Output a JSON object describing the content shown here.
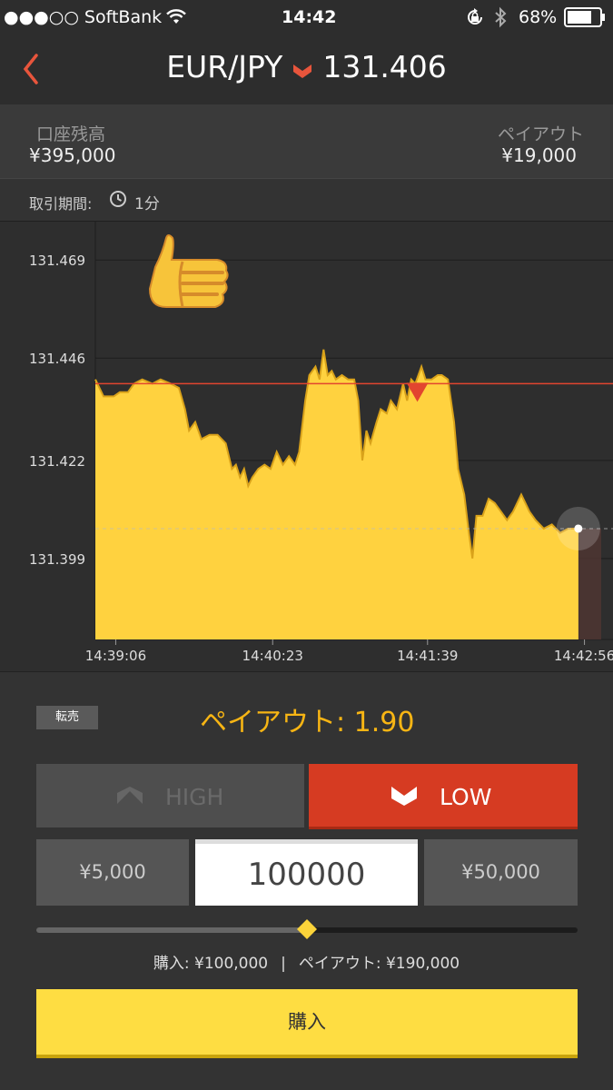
{
  "status_bar": {
    "carrier": "●●●○○ SoftBank",
    "time": "14:42",
    "battery": "68%"
  },
  "header": {
    "pair": "EUR/JPY",
    "price": "131.406",
    "direction_icon": "chevron-down-icon"
  },
  "account": {
    "balance_label": "口座残高",
    "balance_value": "¥395,000",
    "payout_label": "ペイアウト",
    "payout_value": "¥19,000"
  },
  "period": {
    "label": "取引期間:",
    "value": "1分"
  },
  "chart_data": {
    "type": "area",
    "yticks": [
      "131.469",
      "131.446",
      "131.422",
      "131.399"
    ],
    "xticks": [
      "14:39:06",
      "14:40:23",
      "14:41:39",
      "14:42:56"
    ],
    "ylim": [
      131.38,
      131.478
    ],
    "xlim": [
      "14:38:56",
      "14:43:10"
    ],
    "entry_rate": 131.44,
    "entry_marker_time": "14:41:34",
    "current_rate": 131.406,
    "current_time": "14:42:53",
    "expiry_zone_start": "14:42:53",
    "series": [
      {
        "points": [
          [
            "14:38:56",
            131.441
          ],
          [
            "14:38:58",
            131.439
          ],
          [
            "14:39:00",
            131.437
          ],
          [
            "14:39:02",
            131.437
          ],
          [
            "14:39:05",
            131.437
          ],
          [
            "14:39:08",
            131.438
          ],
          [
            "14:39:12",
            131.438
          ],
          [
            "14:39:15",
            131.44
          ],
          [
            "14:39:19",
            131.441
          ],
          [
            "14:39:24",
            131.44
          ],
          [
            "14:39:28",
            131.441
          ],
          [
            "14:39:33",
            131.44
          ],
          [
            "14:39:37",
            131.439
          ],
          [
            "14:39:40",
            131.434
          ],
          [
            "14:39:42",
            131.429
          ],
          [
            "14:39:45",
            131.431
          ],
          [
            "14:39:48",
            131.427
          ],
          [
            "14:39:52",
            131.428
          ],
          [
            "14:39:56",
            131.428
          ],
          [
            "14:40:00",
            131.426
          ],
          [
            "14:40:03",
            131.42
          ],
          [
            "14:40:05",
            131.421
          ],
          [
            "14:40:07",
            131.418
          ],
          [
            "14:40:09",
            131.42
          ],
          [
            "14:40:11",
            131.416
          ],
          [
            "14:40:13",
            131.418
          ],
          [
            "14:40:16",
            131.42
          ],
          [
            "14:40:19",
            131.421
          ],
          [
            "14:40:22",
            131.42
          ],
          [
            "14:40:25",
            131.424
          ],
          [
            "14:40:28",
            131.421
          ],
          [
            "14:40:31",
            131.423
          ],
          [
            "14:40:34",
            131.421
          ],
          [
            "14:40:36",
            131.424
          ],
          [
            "14:40:39",
            131.436
          ],
          [
            "14:40:41",
            131.442
          ],
          [
            "14:40:44",
            131.444
          ],
          [
            "14:40:46",
            131.441
          ],
          [
            "14:40:48",
            131.448
          ],
          [
            "14:40:50",
            131.442
          ],
          [
            "14:40:52",
            131.443
          ],
          [
            "14:40:54",
            131.441
          ],
          [
            "14:40:57",
            131.442
          ],
          [
            "14:41:00",
            131.441
          ],
          [
            "14:41:03",
            131.441
          ],
          [
            "14:41:05",
            131.436
          ],
          [
            "14:41:07",
            131.422
          ],
          [
            "14:41:09",
            131.429
          ],
          [
            "14:41:11",
            131.426
          ],
          [
            "14:41:14",
            131.431
          ],
          [
            "14:41:16",
            131.434
          ],
          [
            "14:41:19",
            131.433
          ],
          [
            "14:41:21",
            131.436
          ],
          [
            "14:41:24",
            131.434
          ],
          [
            "14:41:27",
            131.44
          ],
          [
            "14:41:29",
            131.436
          ],
          [
            "14:41:31",
            131.441
          ],
          [
            "14:41:33",
            131.44
          ],
          [
            "14:41:36",
            131.444
          ],
          [
            "14:41:38",
            131.441
          ],
          [
            "14:41:41",
            131.441
          ],
          [
            "14:41:44",
            131.442
          ],
          [
            "14:41:46",
            131.442
          ],
          [
            "14:41:49",
            131.441
          ],
          [
            "14:41:52",
            131.431
          ],
          [
            "14:41:54",
            131.42
          ],
          [
            "14:41:57",
            131.414
          ],
          [
            "14:41:59",
            131.406
          ],
          [
            "14:42:01",
            131.399
          ],
          [
            "14:42:03",
            131.409
          ],
          [
            "14:42:06",
            131.409
          ],
          [
            "14:42:09",
            131.413
          ],
          [
            "14:42:12",
            131.412
          ],
          [
            "14:42:15",
            131.41
          ],
          [
            "14:42:18",
            131.408
          ],
          [
            "14:42:21",
            131.41
          ],
          [
            "14:42:25",
            131.414
          ],
          [
            "14:42:29",
            131.41
          ],
          [
            "14:42:32",
            131.408
          ],
          [
            "14:42:36",
            131.406
          ],
          [
            "14:42:40",
            131.407
          ],
          [
            "14:42:44",
            131.405
          ],
          [
            "14:42:48",
            131.406
          ],
          [
            "14:42:53",
            131.406
          ]
        ]
      }
    ],
    "colors": {
      "area": "#ffd23f",
      "area_stroke": "#d9a21a",
      "entry_line": "#e2452f",
      "expiry_zone": "#4e3531",
      "grid": "#1d1d1d"
    }
  },
  "trade": {
    "resell_label": "転売",
    "payout_rate": "ペイアウト: 1.90",
    "high_label": "HIGH",
    "low_label": "LOW",
    "preset_low": "¥5,000",
    "amount_value": "100000",
    "preset_high": "¥50,000",
    "slider_value": 0.5,
    "summary_purchase": "購入: ¥100,000",
    "summary_separator": "|",
    "summary_payout": "ペイアウト: ¥190,000",
    "buy_label": "購入"
  },
  "colors": {
    "accent": "#f7b514",
    "low": "#d63b22",
    "buy": "#fedd42"
  }
}
